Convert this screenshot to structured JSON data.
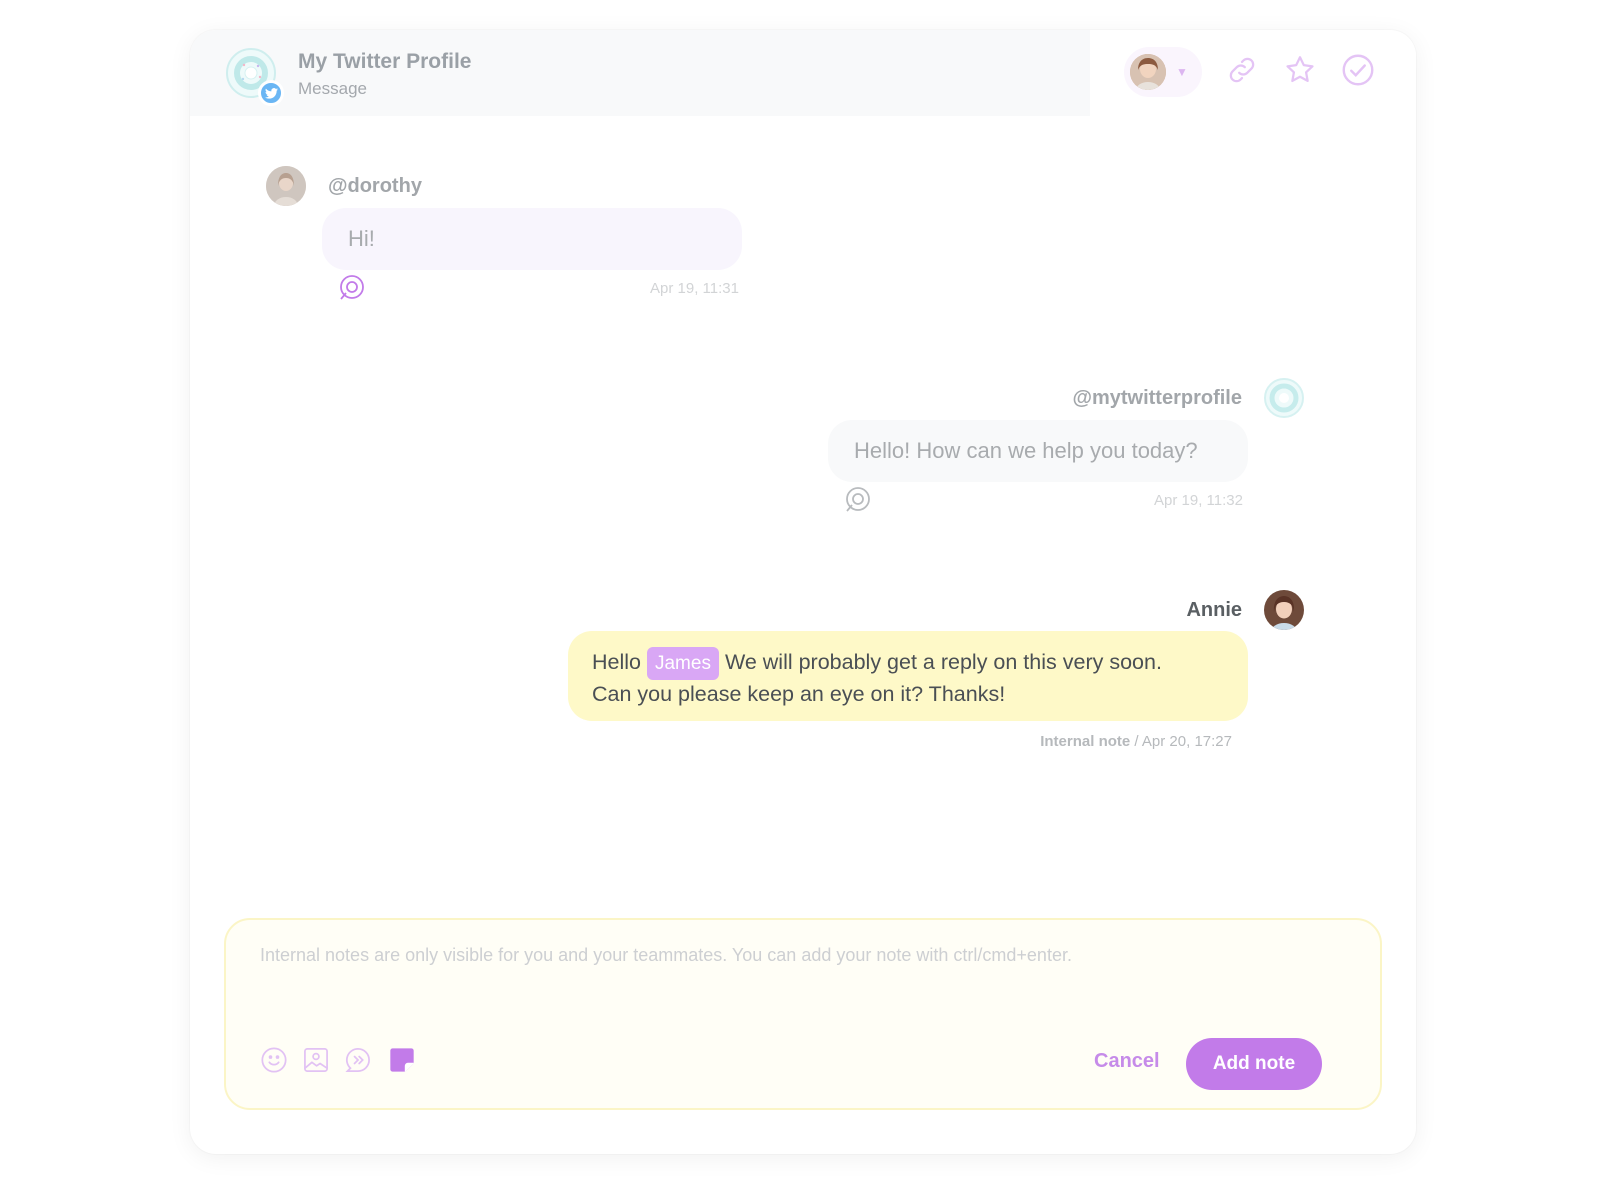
{
  "header": {
    "title": "My Twitter Profile",
    "subtitle": "Message",
    "icons": [
      "twitter-icon",
      "link-icon",
      "star-icon",
      "check-circle-icon"
    ]
  },
  "messages": [
    {
      "author": "@dorothy",
      "text": "Hi!",
      "time": "Apr 19, 11:31"
    },
    {
      "author": "@mytwitterprofile",
      "text": "Hello! How can we help you today?",
      "time": "Apr 19, 11:32"
    },
    {
      "author": "Annie",
      "text_before": "Hello",
      "mention": "James",
      "text_after": "We will probably get a reply on this very soon.",
      "text_line2": "Can you please keep an eye on it? Thanks!",
      "label": "Internal note",
      "separator": "/",
      "time": "Apr 20, 17:27"
    }
  ],
  "composer": {
    "placeholder": "Internal notes are only visible for you and your teammates. You can add your note with ctrl/cmd+enter.",
    "tools": [
      "emoji-icon",
      "image-icon",
      "canned-response-icon",
      "note-icon"
    ],
    "cancel_label": "Cancel",
    "submit_label": "Add note"
  },
  "colors": {
    "accent": "#c27be9",
    "note_bubble": "#fef9c8",
    "mention": "#d9a7f5",
    "twitter": "#6ab6f4"
  }
}
